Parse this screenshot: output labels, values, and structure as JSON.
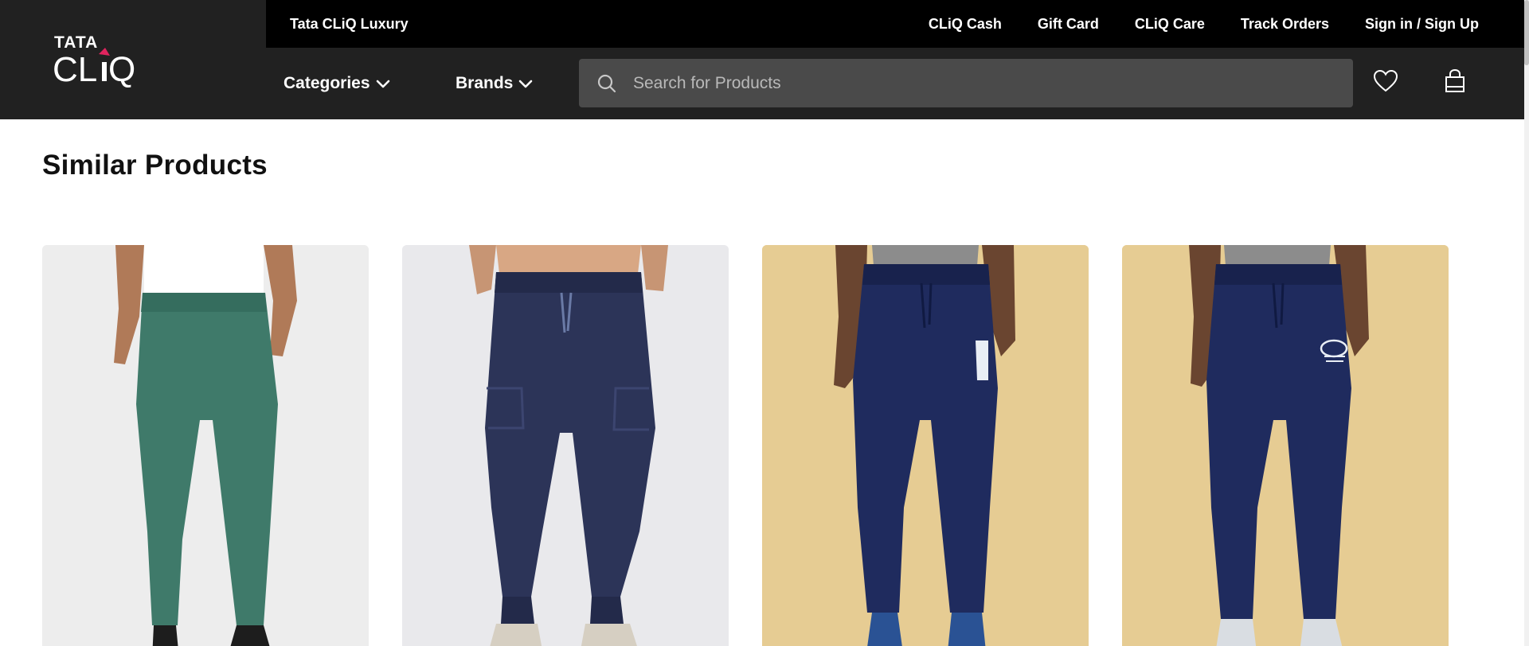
{
  "brand": {
    "logo_top": "TATA",
    "logo_bottom": "CLiQ",
    "logo_accent": "#e0245e"
  },
  "topbar": {
    "luxury_link": "Tata CLiQ Luxury",
    "links": [
      "CLiQ Cash",
      "Gift Card",
      "CLiQ Care",
      "Track Orders",
      "Sign in / Sign Up"
    ]
  },
  "nav": {
    "categories_label": "Categories",
    "brands_label": "Brands",
    "search_placeholder": "Search for Products",
    "wishlist_icon": "heart-icon",
    "bag_icon": "shopping-bag-icon"
  },
  "section": {
    "title": "Similar Products"
  },
  "products": [
    {
      "image": "green track pants",
      "bg": "#ededed",
      "pant": "#3f7a6a"
    },
    {
      "image": "navy joggers",
      "bg": "#e9e9ec",
      "pant": "#2c3458"
    },
    {
      "image": "navy joggers with print",
      "bg": "#e6cc93",
      "pant": "#1f2b5e"
    },
    {
      "image": "navy joggers with logo",
      "bg": "#e6cc93",
      "pant": "#1f2b5e"
    }
  ],
  "colors": {
    "header_bg": "#212121",
    "topbar_bg": "#000000",
    "search_bg": "#4a4a4a"
  }
}
